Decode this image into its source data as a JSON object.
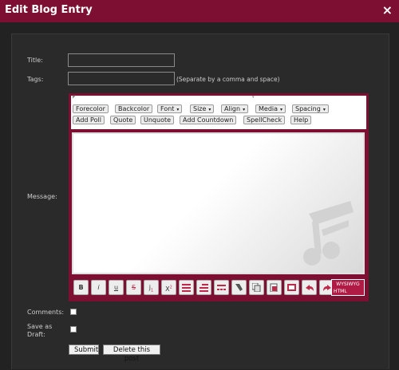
{
  "window": {
    "title": "Edit Blog Entry",
    "close_glyph": "×"
  },
  "form": {
    "title_label": "Title:",
    "title_value": "",
    "tags_label": "Tags:",
    "tags_value": "",
    "tags_hint": "(Separate by a comma and space)",
    "message_label": "Message:",
    "comments_label": "Comments:",
    "comments_checked": false,
    "draft_label_1": "Save as",
    "draft_label_2": "Draft:",
    "draft_checked": false,
    "submit_label": "Submit",
    "delete_label": "Delete this post"
  },
  "toolbar": {
    "forecolor": "Forecolor",
    "backcolor": "Backcolor",
    "font": "Font",
    "size": "Size",
    "align": "Align",
    "media": "Media",
    "spacing": "Spacing",
    "add_poll": "Add Poll",
    "quote": "Quote",
    "unquote": "Unquote",
    "add_countdown": "Add Countdown",
    "spellcheck": "SpellCheck",
    "help": "Help",
    "dropdown_caret": "▾"
  },
  "format_toolbar": {
    "bold": "B",
    "italic": "i",
    "underline": "u",
    "strike": "S",
    "subscript": "1",
    "superscript": "X",
    "wysiwyg": "WYSIWYG",
    "html": "HTML",
    "icons": [
      "bold-icon",
      "italic-icon",
      "underline-icon",
      "strikethrough-icon",
      "subscript-icon",
      "superscript-icon",
      "ordered-list-icon",
      "unordered-list-icon",
      "horizontal-rule-icon",
      "link-icon",
      "copy-icon",
      "paste-icon",
      "image-icon",
      "undo-icon",
      "redo-icon"
    ]
  },
  "colors": {
    "brand": "#7d0f32",
    "accent": "#b01b45",
    "background": "#222222"
  }
}
